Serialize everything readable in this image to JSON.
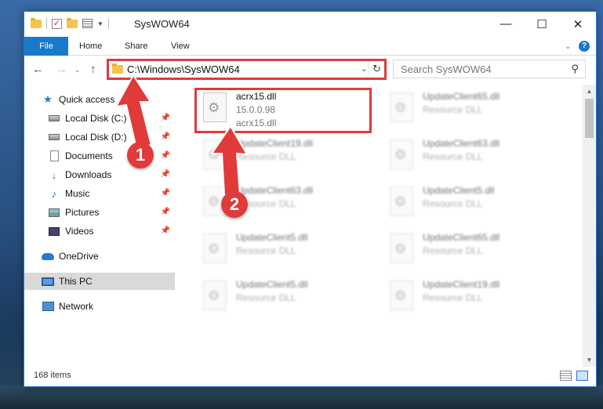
{
  "window": {
    "title": "SysWOW64"
  },
  "ribbon": {
    "tabs": [
      "File",
      "Home",
      "Share",
      "View"
    ]
  },
  "nav": {
    "address": "C:\\Windows\\SysWOW64",
    "search_placeholder": "Search SysWOW64"
  },
  "sidebar": {
    "quick_access": "Quick access",
    "items": [
      {
        "label": "Local Disk (C:)",
        "icon": "drive-icon"
      },
      {
        "label": "Local Disk (D:)",
        "icon": "drive-icon"
      },
      {
        "label": "Documents",
        "icon": "documents-icon"
      },
      {
        "label": "Downloads",
        "icon": "downloads-icon"
      },
      {
        "label": "Music",
        "icon": "music-icon"
      },
      {
        "label": "Pictures",
        "icon": "pictures-icon"
      },
      {
        "label": "Videos",
        "icon": "videos-icon"
      }
    ],
    "onedrive": "OneDrive",
    "this_pc": "This PC",
    "network": "Network"
  },
  "files": [
    {
      "name": "acrx15.dll",
      "sub": "15.0.0.98",
      "sub2": "acrx15.dll"
    },
    {
      "name": "UpdateClient65.dll",
      "sub": "Resource DLL"
    },
    {
      "name": "UpdateClient19.dll",
      "sub": "Resource DLL"
    },
    {
      "name": "UpdateClient63.dll",
      "sub": "Resource DLL"
    },
    {
      "name": "UpdateClient63.dll",
      "sub": "Resource DLL"
    },
    {
      "name": "UpdateClient5.dll",
      "sub": "Resource DLL"
    },
    {
      "name": "UpdateClient5.dll",
      "sub": "Resource DLL"
    },
    {
      "name": "UpdateClient65.dll",
      "sub": "Resource DLL"
    },
    {
      "name": "UpdateClient5.dll",
      "sub": "Resource DLL"
    },
    {
      "name": "UpdateClient19.dll",
      "sub": "Resource DLL"
    }
  ],
  "status": {
    "count": "168 items"
  },
  "annotations": {
    "marker1": "1",
    "marker2": "2",
    "color": "#e03a3a"
  }
}
